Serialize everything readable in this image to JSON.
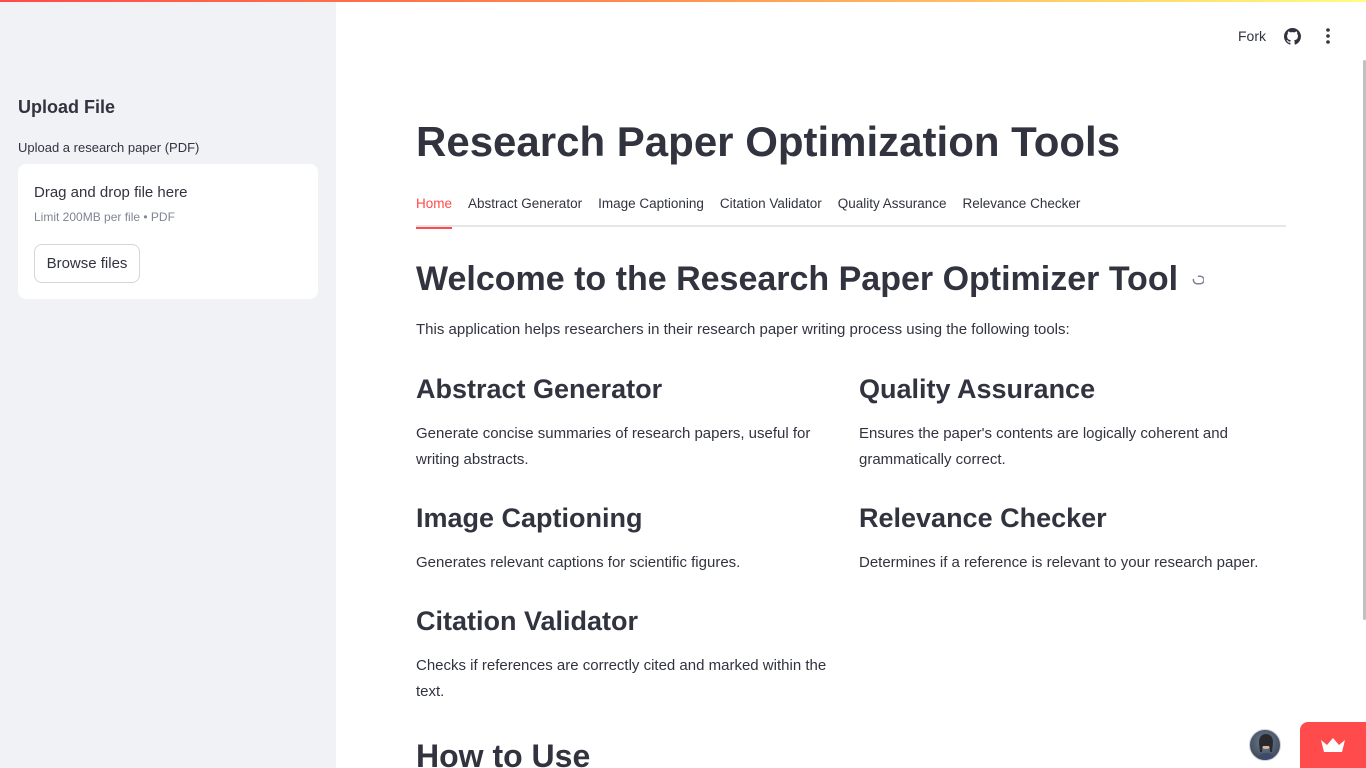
{
  "header": {
    "fork_label": "Fork",
    "icons": [
      "github-icon",
      "more-vertical-icon"
    ]
  },
  "sidebar": {
    "title": "Upload File",
    "upload_label": "Upload a research paper (PDF)",
    "dropzone": {
      "title": "Drag and drop file here",
      "limit": "Limit 200MB per file • PDF",
      "browse_label": "Browse files"
    }
  },
  "main": {
    "title": "Research Paper Optimization Tools",
    "tabs": [
      {
        "label": "Home",
        "active": true
      },
      {
        "label": "Abstract Generator",
        "active": false
      },
      {
        "label": "Image Captioning",
        "active": false
      },
      {
        "label": "Citation Validator",
        "active": false
      },
      {
        "label": "Quality Assurance",
        "active": false
      },
      {
        "label": "Relevance Checker",
        "active": false
      }
    ],
    "welcome_heading": "Welcome to the Research Paper Optimizer Tool",
    "intro": "This application helps researchers in their research paper writing process using the following tools:",
    "features": {
      "abstract": {
        "title": "Abstract Generator",
        "desc": "Generate concise summaries of research papers, useful for writing abstracts."
      },
      "quality": {
        "title": "Quality Assurance",
        "desc": "Ensures the paper's contents are logically coherent and grammatically correct."
      },
      "image": {
        "title": "Image Captioning",
        "desc": "Generates relevant captions for scientific figures."
      },
      "relevance": {
        "title": "Relevance Checker",
        "desc": "Determines if a reference is relevant to your research paper."
      },
      "citation": {
        "title": "Citation Validator",
        "desc": "Checks if references are correctly cited and marked within the text."
      }
    },
    "how_to_heading": "How to Use"
  },
  "colors": {
    "accent": "#ff4b4b",
    "sidebar_bg": "#f0f2f6",
    "text": "#31333f"
  }
}
